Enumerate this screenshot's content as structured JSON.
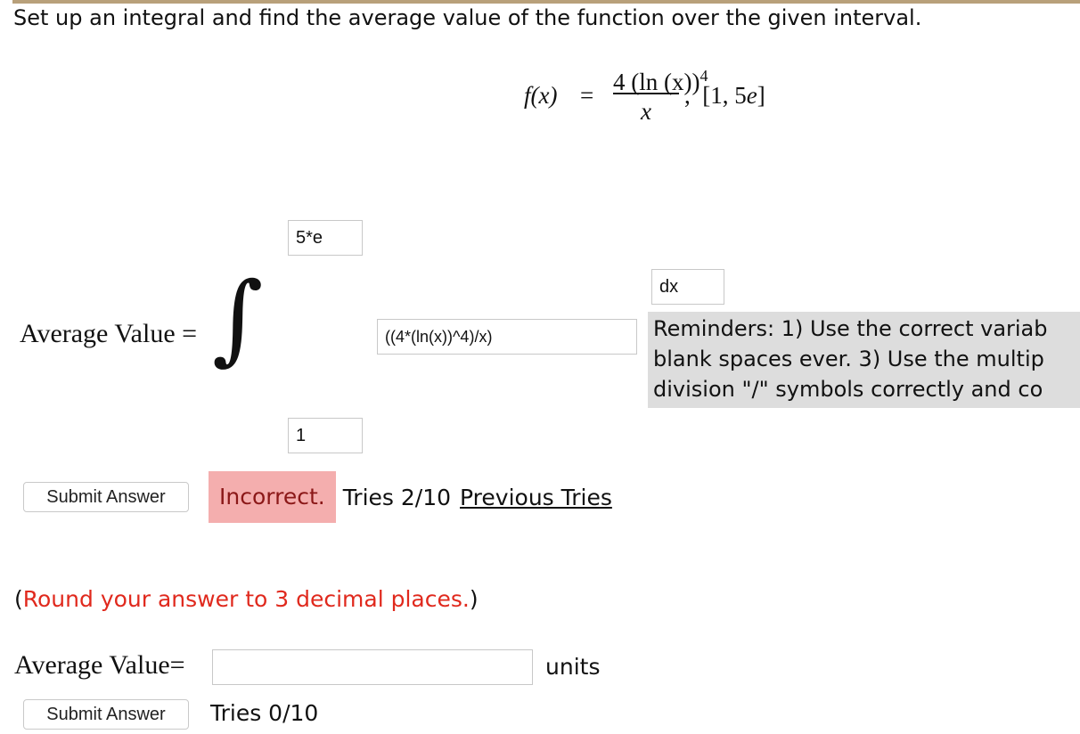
{
  "question": {
    "prompt": "Set up an integral and find the average value of the function over the given interval."
  },
  "formula": {
    "lhs": "f(x)",
    "equals": "=",
    "numerator": "4 (ln (x))",
    "numerator_exponent": "4",
    "denominator": "x",
    "interval_sep": ",",
    "interval_open": "[1, 5",
    "interval_e": "e",
    "interval_close": "]"
  },
  "integral_part": {
    "label": "Average Value =",
    "upper_limit_value": "5*e",
    "lower_limit_value": "1",
    "integrand_value": "((4*(ln(x))^4)/x)",
    "differential_value": "dx",
    "reminder_lines": [
      "Reminders: 1) Use the correct variab",
      "blank spaces ever. 3) Use the multip",
      "division \"/\" symbols correctly and co"
    ],
    "submit_label": "Submit Answer",
    "status_label": "Incorrect.",
    "tries_text": "Tries 2/10",
    "previous_tries_label": "Previous Tries"
  },
  "rounding": {
    "open_paren": "(",
    "text": "Round your answer to 3 decimal places.",
    "close_paren": ")"
  },
  "value_part": {
    "label": "Average Value=",
    "input_value": "",
    "units_label": "units",
    "submit_label": "Submit Answer",
    "tries_text": "Tries 0/10"
  },
  "colors": {
    "incorrect_bg": "#f4aeae",
    "incorrect_text": "#8b1818",
    "round_note_red": "#e0291d",
    "reminder_bg": "#dddddd",
    "top_rule": "#b8a07a"
  }
}
